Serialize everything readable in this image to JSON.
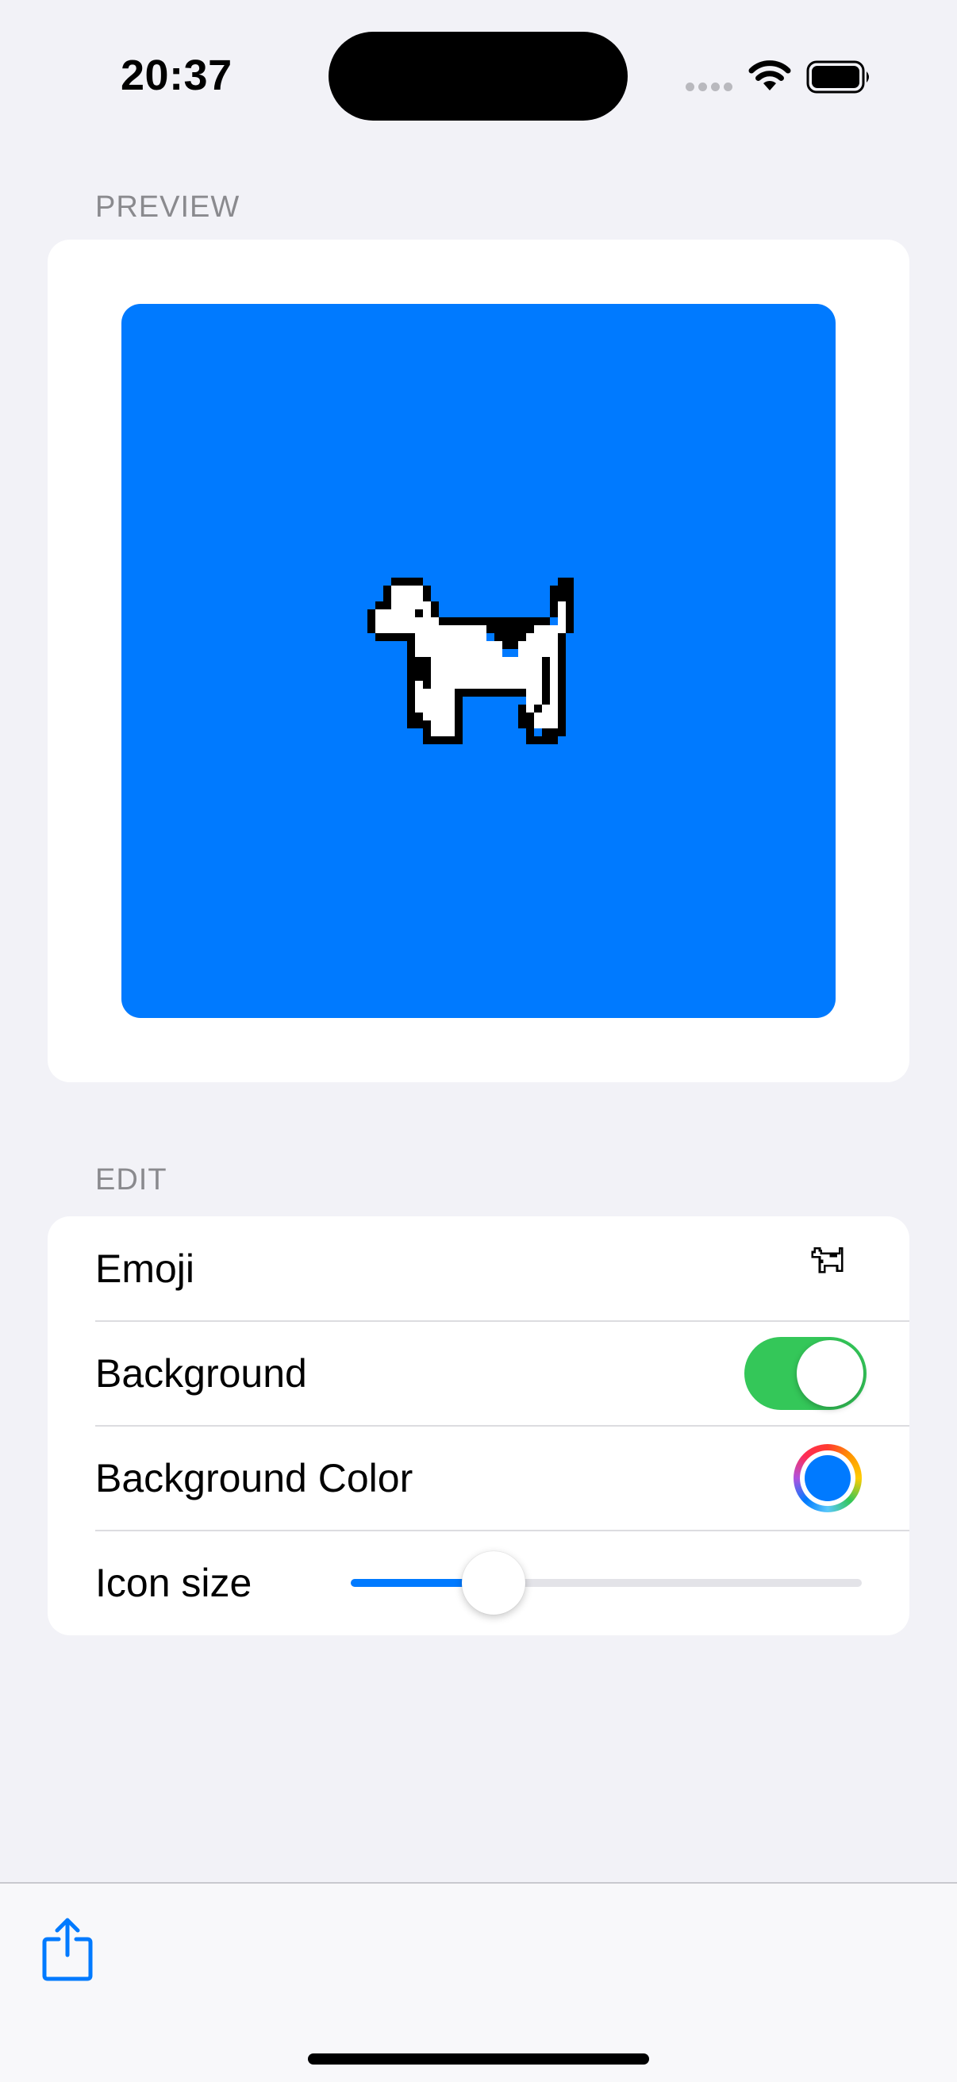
{
  "status_bar": {
    "time": "20:37",
    "wifi_icon": "wifi-icon",
    "battery_icon": "battery-icon"
  },
  "preview": {
    "header": "PREVIEW",
    "icon": "dog-icon",
    "background_color": "#007aff"
  },
  "edit": {
    "header": "EDIT",
    "rows": [
      {
        "label": "Emoji",
        "value_icon": "dog-icon"
      },
      {
        "label": "Background",
        "toggle_on": true
      },
      {
        "label": "Background Color",
        "color": "#007aff"
      },
      {
        "label": "Icon size",
        "slider_value": 0.28
      }
    ]
  },
  "toolbar": {
    "share_icon": "share-icon"
  },
  "colors": {
    "accent": "#007aff",
    "toggle_on": "#34c759",
    "background": "#f2f2f7"
  }
}
